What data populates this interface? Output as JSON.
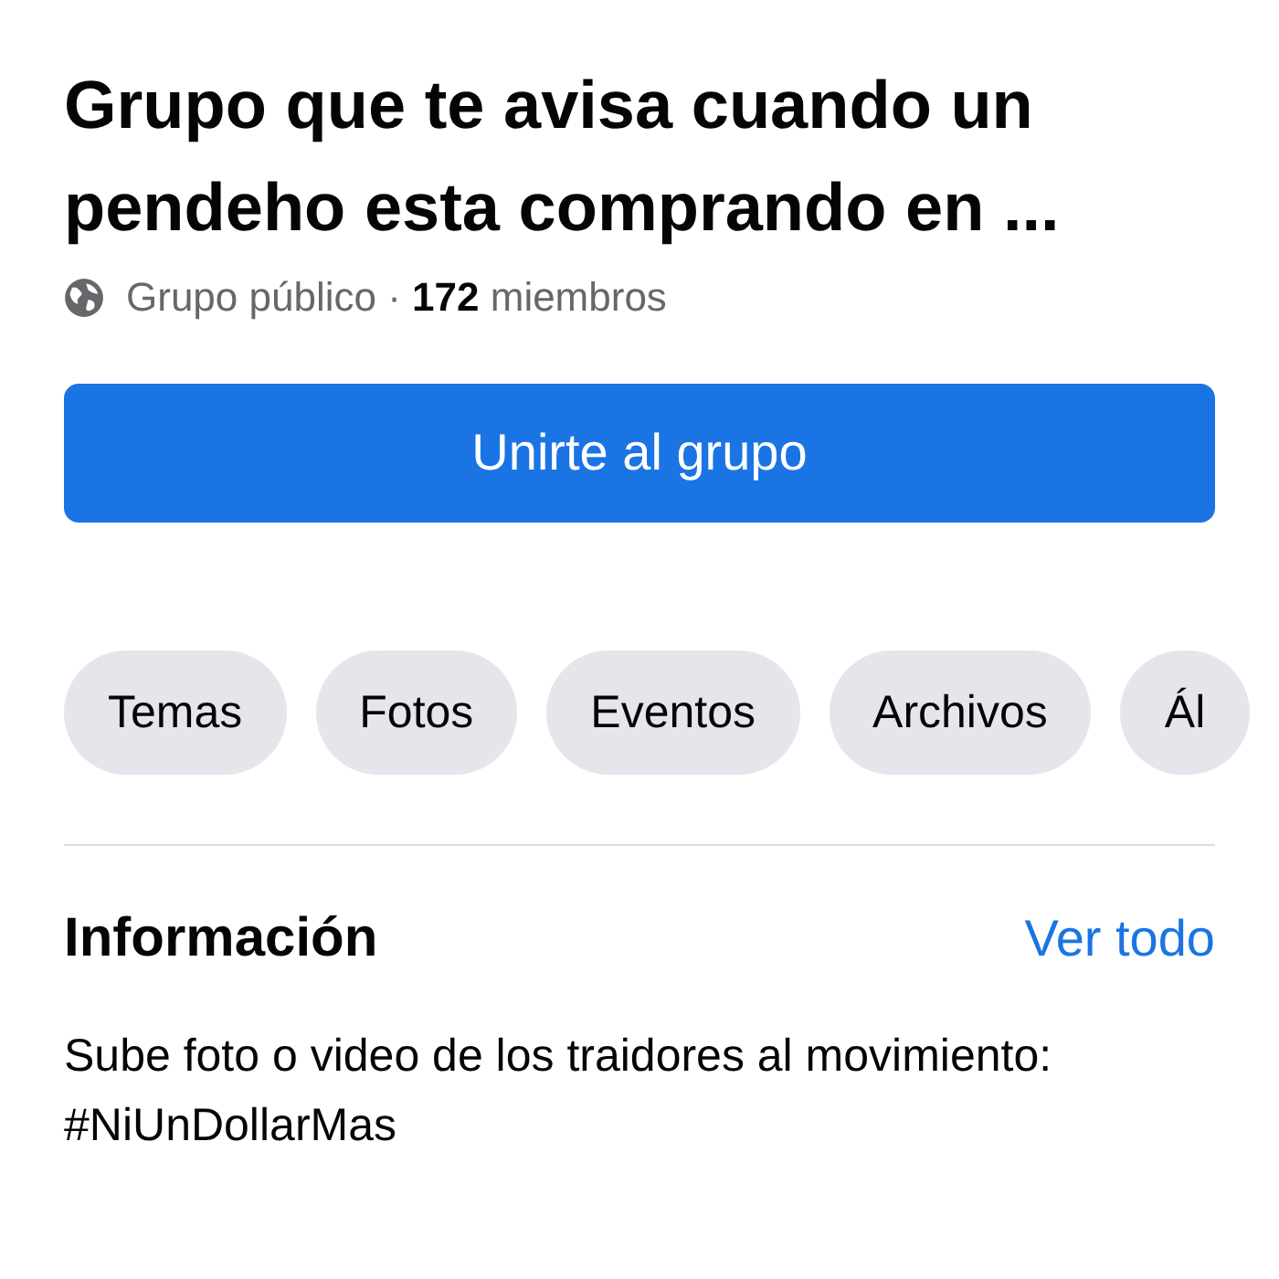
{
  "group": {
    "title": "Grupo que te avisa cuando un pendeho esta comprando en ...",
    "privacy": "Grupo público",
    "separator": "·",
    "member_count": "172",
    "members_label": "miembros"
  },
  "join_button": {
    "label": "Unirte al grupo"
  },
  "tabs": [
    {
      "label": "Temas",
      "selected": false
    },
    {
      "label": "Fotos",
      "selected": false
    },
    {
      "label": "Eventos",
      "selected": false
    },
    {
      "label": "Archivos",
      "selected": false
    },
    {
      "label": "Ál",
      "selected": false
    }
  ],
  "about": {
    "heading": "Información",
    "see_all": "Ver todo",
    "description": "Sube foto o video de los traidores al movimiento: #NiUnDollarMas"
  }
}
